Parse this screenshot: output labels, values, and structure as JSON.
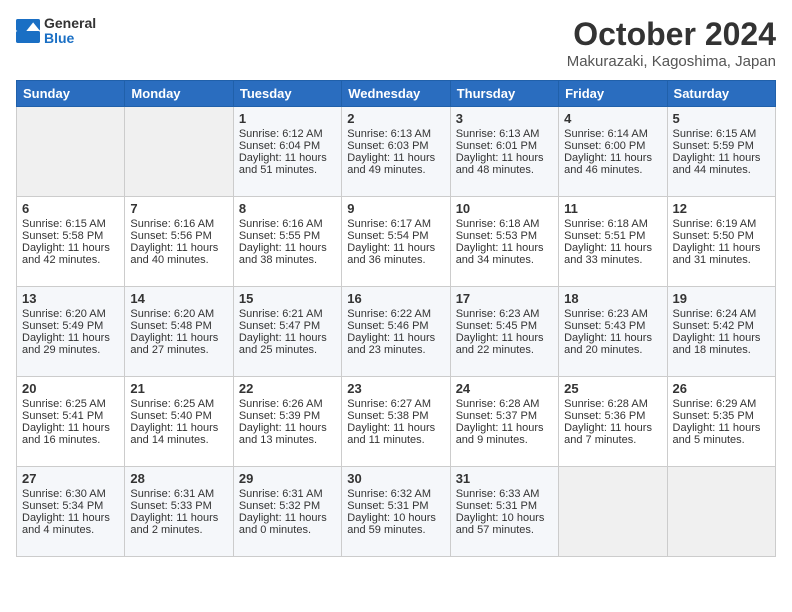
{
  "header": {
    "logo_general": "General",
    "logo_blue": "Blue",
    "month": "October 2024",
    "location": "Makurazaki, Kagoshima, Japan"
  },
  "weekdays": [
    "Sunday",
    "Monday",
    "Tuesday",
    "Wednesday",
    "Thursday",
    "Friday",
    "Saturday"
  ],
  "weeks": [
    [
      {
        "day": "",
        "sunrise": "",
        "sunset": "",
        "daylight": "",
        "empty": true
      },
      {
        "day": "",
        "sunrise": "",
        "sunset": "",
        "daylight": "",
        "empty": true
      },
      {
        "day": "1",
        "sunrise": "Sunrise: 6:12 AM",
        "sunset": "Sunset: 6:04 PM",
        "daylight": "Daylight: 11 hours and 51 minutes."
      },
      {
        "day": "2",
        "sunrise": "Sunrise: 6:13 AM",
        "sunset": "Sunset: 6:03 PM",
        "daylight": "Daylight: 11 hours and 49 minutes."
      },
      {
        "day": "3",
        "sunrise": "Sunrise: 6:13 AM",
        "sunset": "Sunset: 6:01 PM",
        "daylight": "Daylight: 11 hours and 48 minutes."
      },
      {
        "day": "4",
        "sunrise": "Sunrise: 6:14 AM",
        "sunset": "Sunset: 6:00 PM",
        "daylight": "Daylight: 11 hours and 46 minutes."
      },
      {
        "day": "5",
        "sunrise": "Sunrise: 6:15 AM",
        "sunset": "Sunset: 5:59 PM",
        "daylight": "Daylight: 11 hours and 44 minutes."
      }
    ],
    [
      {
        "day": "6",
        "sunrise": "Sunrise: 6:15 AM",
        "sunset": "Sunset: 5:58 PM",
        "daylight": "Daylight: 11 hours and 42 minutes."
      },
      {
        "day": "7",
        "sunrise": "Sunrise: 6:16 AM",
        "sunset": "Sunset: 5:56 PM",
        "daylight": "Daylight: 11 hours and 40 minutes."
      },
      {
        "day": "8",
        "sunrise": "Sunrise: 6:16 AM",
        "sunset": "Sunset: 5:55 PM",
        "daylight": "Daylight: 11 hours and 38 minutes."
      },
      {
        "day": "9",
        "sunrise": "Sunrise: 6:17 AM",
        "sunset": "Sunset: 5:54 PM",
        "daylight": "Daylight: 11 hours and 36 minutes."
      },
      {
        "day": "10",
        "sunrise": "Sunrise: 6:18 AM",
        "sunset": "Sunset: 5:53 PM",
        "daylight": "Daylight: 11 hours and 34 minutes."
      },
      {
        "day": "11",
        "sunrise": "Sunrise: 6:18 AM",
        "sunset": "Sunset: 5:51 PM",
        "daylight": "Daylight: 11 hours and 33 minutes."
      },
      {
        "day": "12",
        "sunrise": "Sunrise: 6:19 AM",
        "sunset": "Sunset: 5:50 PM",
        "daylight": "Daylight: 11 hours and 31 minutes."
      }
    ],
    [
      {
        "day": "13",
        "sunrise": "Sunrise: 6:20 AM",
        "sunset": "Sunset: 5:49 PM",
        "daylight": "Daylight: 11 hours and 29 minutes."
      },
      {
        "day": "14",
        "sunrise": "Sunrise: 6:20 AM",
        "sunset": "Sunset: 5:48 PM",
        "daylight": "Daylight: 11 hours and 27 minutes."
      },
      {
        "day": "15",
        "sunrise": "Sunrise: 6:21 AM",
        "sunset": "Sunset: 5:47 PM",
        "daylight": "Daylight: 11 hours and 25 minutes."
      },
      {
        "day": "16",
        "sunrise": "Sunrise: 6:22 AM",
        "sunset": "Sunset: 5:46 PM",
        "daylight": "Daylight: 11 hours and 23 minutes."
      },
      {
        "day": "17",
        "sunrise": "Sunrise: 6:23 AM",
        "sunset": "Sunset: 5:45 PM",
        "daylight": "Daylight: 11 hours and 22 minutes."
      },
      {
        "day": "18",
        "sunrise": "Sunrise: 6:23 AM",
        "sunset": "Sunset: 5:43 PM",
        "daylight": "Daylight: 11 hours and 20 minutes."
      },
      {
        "day": "19",
        "sunrise": "Sunrise: 6:24 AM",
        "sunset": "Sunset: 5:42 PM",
        "daylight": "Daylight: 11 hours and 18 minutes."
      }
    ],
    [
      {
        "day": "20",
        "sunrise": "Sunrise: 6:25 AM",
        "sunset": "Sunset: 5:41 PM",
        "daylight": "Daylight: 11 hours and 16 minutes."
      },
      {
        "day": "21",
        "sunrise": "Sunrise: 6:25 AM",
        "sunset": "Sunset: 5:40 PM",
        "daylight": "Daylight: 11 hours and 14 minutes."
      },
      {
        "day": "22",
        "sunrise": "Sunrise: 6:26 AM",
        "sunset": "Sunset: 5:39 PM",
        "daylight": "Daylight: 11 hours and 13 minutes."
      },
      {
        "day": "23",
        "sunrise": "Sunrise: 6:27 AM",
        "sunset": "Sunset: 5:38 PM",
        "daylight": "Daylight: 11 hours and 11 minutes."
      },
      {
        "day": "24",
        "sunrise": "Sunrise: 6:28 AM",
        "sunset": "Sunset: 5:37 PM",
        "daylight": "Daylight: 11 hours and 9 minutes."
      },
      {
        "day": "25",
        "sunrise": "Sunrise: 6:28 AM",
        "sunset": "Sunset: 5:36 PM",
        "daylight": "Daylight: 11 hours and 7 minutes."
      },
      {
        "day": "26",
        "sunrise": "Sunrise: 6:29 AM",
        "sunset": "Sunset: 5:35 PM",
        "daylight": "Daylight: 11 hours and 5 minutes."
      }
    ],
    [
      {
        "day": "27",
        "sunrise": "Sunrise: 6:30 AM",
        "sunset": "Sunset: 5:34 PM",
        "daylight": "Daylight: 11 hours and 4 minutes."
      },
      {
        "day": "28",
        "sunrise": "Sunrise: 6:31 AM",
        "sunset": "Sunset: 5:33 PM",
        "daylight": "Daylight: 11 hours and 2 minutes."
      },
      {
        "day": "29",
        "sunrise": "Sunrise: 6:31 AM",
        "sunset": "Sunset: 5:32 PM",
        "daylight": "Daylight: 11 hours and 0 minutes."
      },
      {
        "day": "30",
        "sunrise": "Sunrise: 6:32 AM",
        "sunset": "Sunset: 5:31 PM",
        "daylight": "Daylight: 10 hours and 59 minutes."
      },
      {
        "day": "31",
        "sunrise": "Sunrise: 6:33 AM",
        "sunset": "Sunset: 5:31 PM",
        "daylight": "Daylight: 10 hours and 57 minutes."
      },
      {
        "day": "",
        "sunrise": "",
        "sunset": "",
        "daylight": "",
        "empty": true
      },
      {
        "day": "",
        "sunrise": "",
        "sunset": "",
        "daylight": "",
        "empty": true
      }
    ]
  ]
}
